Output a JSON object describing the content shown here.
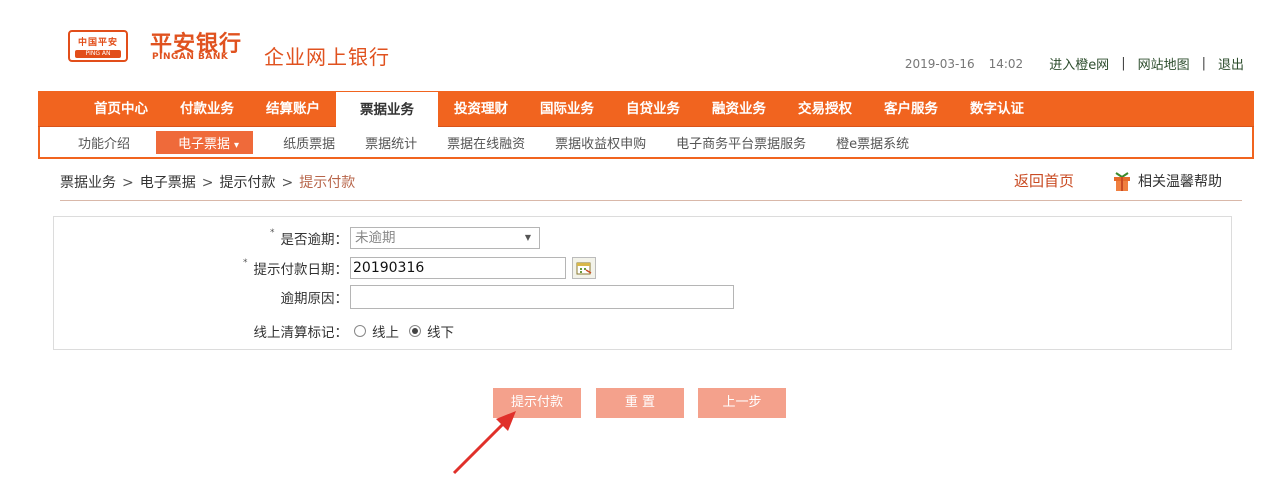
{
  "header": {
    "badge_line1": "中国平安",
    "badge_line2": "PING AN",
    "logo_cn": "平安银行",
    "logo_en": "PINGAN BANK",
    "portal_title": "企业网上银行",
    "date": "2019-03-16",
    "time": "14:02",
    "links": [
      "进入橙e网",
      "网站地图",
      "退出"
    ],
    "separator": "|"
  },
  "main_nav": {
    "items": [
      "首页中心",
      "付款业务",
      "结算账户",
      "票据业务",
      "投资理财",
      "国际业务",
      "自贷业务",
      "融资业务",
      "交易授权",
      "客户服务",
      "数字认证"
    ],
    "active_index": 3
  },
  "sub_nav": {
    "items": [
      "功能介绍",
      "电子票据",
      "纸质票据",
      "票据统计",
      "票据在线融资",
      "票据收益权申购",
      "电子商务平台票据服务",
      "橙e票据系统"
    ],
    "active_index": 1,
    "dropdown_marker": "▾"
  },
  "breadcrumb": {
    "items": [
      "票据业务",
      "电子票据",
      "提示付款",
      "提示付款"
    ],
    "arrow": ">",
    "home_link": "返回首页",
    "help_link": "相关温馨帮助"
  },
  "form": {
    "required_mark": "*",
    "overdue": {
      "label": "是否逾期：",
      "value": "未逾期",
      "caret": "▼"
    },
    "pay_date": {
      "label": "提示付款日期：",
      "value": "20190316"
    },
    "reason": {
      "label": "逾期原因：",
      "value": ""
    },
    "settle": {
      "label": "线上清算标记：",
      "options": [
        "线上",
        "线下"
      ],
      "selected": "线下"
    }
  },
  "buttons": {
    "submit": "提示付款",
    "reset": "重 置",
    "back": "上一步"
  },
  "colors": {
    "brand_orange": "#f1641f",
    "button_pink": "#f4a18c",
    "arrow_red": "#e0302a"
  }
}
